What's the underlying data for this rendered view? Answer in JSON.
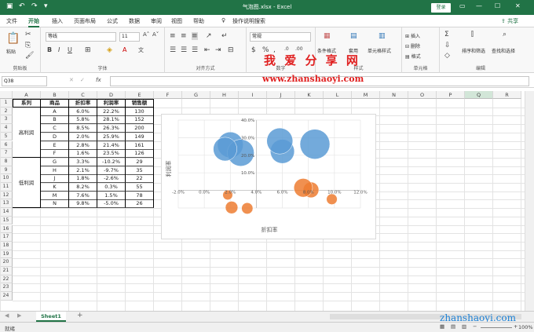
{
  "titlebar": {
    "save_icon": "save-icon",
    "undo_icon": "undo-icon",
    "redo_icon": "redo-icon",
    "title": "气泡图.xlsx - Excel",
    "login": "登录"
  },
  "tabs": [
    {
      "label": "文件"
    },
    {
      "label": "开始"
    },
    {
      "label": "插入"
    },
    {
      "label": "页面布局"
    },
    {
      "label": "公式"
    },
    {
      "label": "数据"
    },
    {
      "label": "审阅"
    },
    {
      "label": "视图"
    },
    {
      "label": "帮助"
    },
    {
      "label": "操作说明搜索"
    }
  ],
  "share": "共享",
  "ribbon": {
    "clipboard": {
      "paste": "粘贴",
      "label": "剪贴板"
    },
    "font": {
      "name": "等线",
      "size": "11",
      "label": "字体"
    },
    "align": {
      "label": "对齐方式"
    },
    "number": {
      "format": "常规",
      "label": "数字"
    },
    "styles": {
      "cond": "条件格式",
      "table": "套用",
      "cellstyle": "单元格样式",
      "label": "样式"
    },
    "cells": {
      "insert": "插入",
      "delete": "删除",
      "format": "格式",
      "label": "单元格"
    },
    "edit": {
      "sort": "排序和筛选",
      "find": "查找和选择",
      "label": "编辑"
    }
  },
  "formula": {
    "namebox": "Q38",
    "fx": "fx"
  },
  "columns": [
    "A",
    "B",
    "C",
    "D",
    "E",
    "F",
    "G",
    "H",
    "I",
    "J",
    "K",
    "L",
    "M",
    "N",
    "O",
    "P",
    "Q",
    "R"
  ],
  "rows": [
    "1",
    "2",
    "3",
    "4",
    "5",
    "6",
    "7",
    "8",
    "9",
    "10",
    "11",
    "12",
    "13",
    "14",
    "15",
    "16",
    "17",
    "18",
    "19",
    "20",
    "21",
    "22",
    "23",
    "24"
  ],
  "table": {
    "headers": [
      "系列",
      "商品",
      "折扣率",
      "利润率",
      "销售额"
    ],
    "groups": [
      "高利润",
      "低利润"
    ],
    "rows": [
      [
        "A",
        "6.0%",
        "22.2%",
        "130"
      ],
      [
        "B",
        "5.8%",
        "28.1%",
        "152"
      ],
      [
        "C",
        "8.5%",
        "26.3%",
        "200"
      ],
      [
        "D",
        "2.0%",
        "25.9%",
        "149"
      ],
      [
        "E",
        "2.8%",
        "21.4%",
        "161"
      ],
      [
        "F",
        "1.6%",
        "23.5%",
        "126"
      ],
      [
        "G",
        "3.3%",
        "-10.2%",
        "29"
      ],
      [
        "H",
        "2.1%",
        "-9.7%",
        "35"
      ],
      [
        "J",
        "1.8%",
        "-2.6%",
        "22"
      ],
      [
        "K",
        "8.2%",
        "0.3%",
        "55"
      ],
      [
        "M",
        "7.6%",
        "1.5%",
        "78"
      ],
      [
        "N",
        "9.8%",
        "-5.0%",
        "26"
      ]
    ]
  },
  "chart_data": {
    "type": "scatter",
    "xlabel": "折扣率",
    "ylabel": "利润率",
    "xlim": [
      -0.02,
      0.12
    ],
    "ylim": [
      -0.1,
      0.4
    ],
    "xticks": [
      "-2.0%",
      "0.0%",
      "2.0%",
      "4.0%",
      "6.0%",
      "8.0%",
      "10.0%",
      "12.0%"
    ],
    "yticks": [
      "40.0%",
      "30.0%",
      "20.0%",
      "10.0%"
    ],
    "colors": [
      "#5b9bd5",
      "#ed7d31"
    ],
    "series": [
      {
        "points": [
          [
            0.06,
            0.222,
            130
          ],
          [
            0.058,
            0.281,
            152
          ],
          [
            0.085,
            0.263,
            200
          ],
          [
            0.02,
            0.259,
            149
          ],
          [
            0.028,
            0.214,
            161
          ],
          [
            0.016,
            0.235,
            126
          ]
        ]
      },
      {
        "points": [
          [
            0.033,
            -0.102,
            29
          ],
          [
            0.021,
            -0.097,
            35
          ],
          [
            0.018,
            -0.026,
            22
          ],
          [
            0.082,
            0.003,
            55
          ],
          [
            0.076,
            0.015,
            78
          ],
          [
            0.098,
            -0.05,
            26
          ]
        ]
      }
    ]
  },
  "sheet": {
    "tab": "Sheet1",
    "add": "+"
  },
  "status": {
    "ready": "就绪",
    "zoom": "100%"
  },
  "watermark": {
    "line1": "我 爱 分 享 网",
    "line2": "www.zhanshaoyi.com",
    "line3": "zhanshaoyi.com"
  }
}
